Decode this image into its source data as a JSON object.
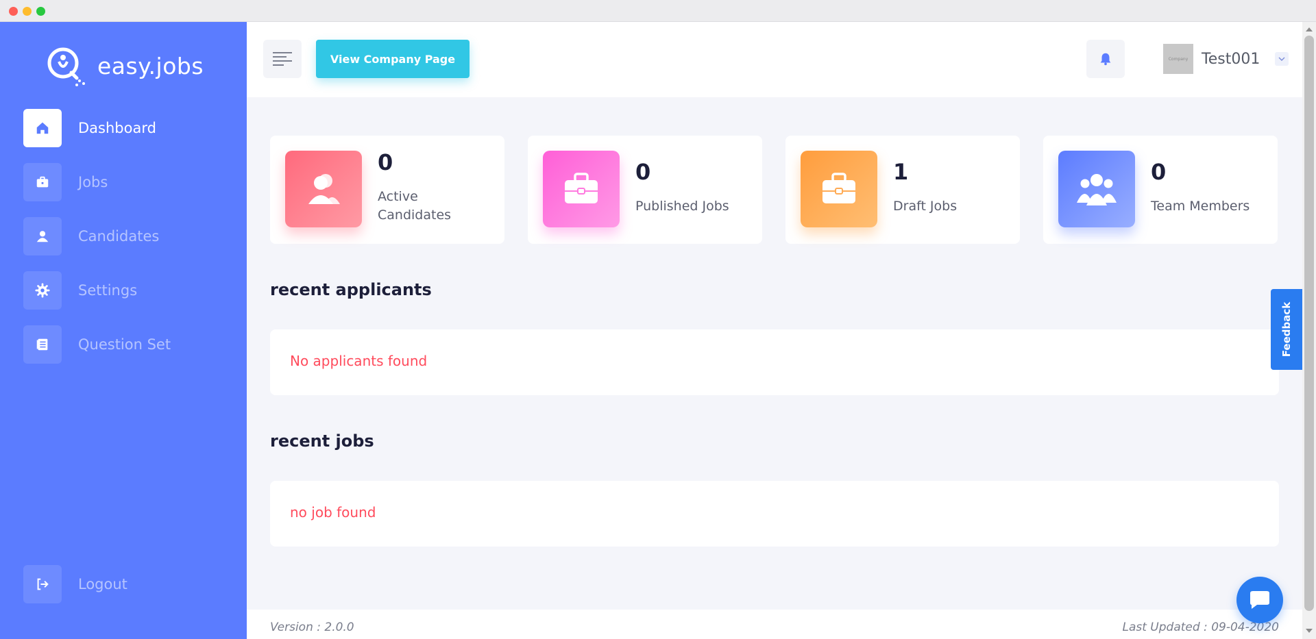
{
  "brand": {
    "name": "easy.jobs"
  },
  "sidebar": {
    "items": [
      {
        "label": "Dashboard",
        "icon": "home-icon",
        "active": true
      },
      {
        "label": "Jobs",
        "icon": "briefcase-icon",
        "active": false
      },
      {
        "label": "Candidates",
        "icon": "user-icon",
        "active": false
      },
      {
        "label": "Settings",
        "icon": "gear-icon",
        "active": false
      },
      {
        "label": "Question Set",
        "icon": "document-icon",
        "active": false
      }
    ],
    "logout": {
      "label": "Logout",
      "icon": "logout-icon"
    }
  },
  "header": {
    "view_company_label": "View Company Page",
    "user": {
      "name": "Test001",
      "avatar_text": "Company"
    }
  },
  "stats": [
    {
      "value": "0",
      "label": "Active Candidates",
      "icon": "candidates-icon",
      "color": "#ff6a7d"
    },
    {
      "value": "0",
      "label": "Published Jobs",
      "icon": "briefcase-icon",
      "color": "#ff5fd7"
    },
    {
      "value": "1",
      "label": "Draft Jobs",
      "icon": "briefcase-icon",
      "color": "#ff9d3d"
    },
    {
      "value": "0",
      "label": "Team Members",
      "icon": "team-icon",
      "color": "#5c7cff"
    }
  ],
  "recent_applicants": {
    "title": "recent applicants",
    "empty_text": "No applicants found"
  },
  "recent_jobs": {
    "title": "recent jobs",
    "empty_text": "no job found"
  },
  "footer": {
    "version": "Version : 2.0.0",
    "last_updated": "Last Updated : 09-04-2020"
  },
  "feedback": {
    "label": "Feedback"
  },
  "colors": {
    "sidebar": "#5b7cff",
    "accent": "#31c7e5",
    "empty_text": "#ff4b5c",
    "widget": "#2a7cf0"
  }
}
